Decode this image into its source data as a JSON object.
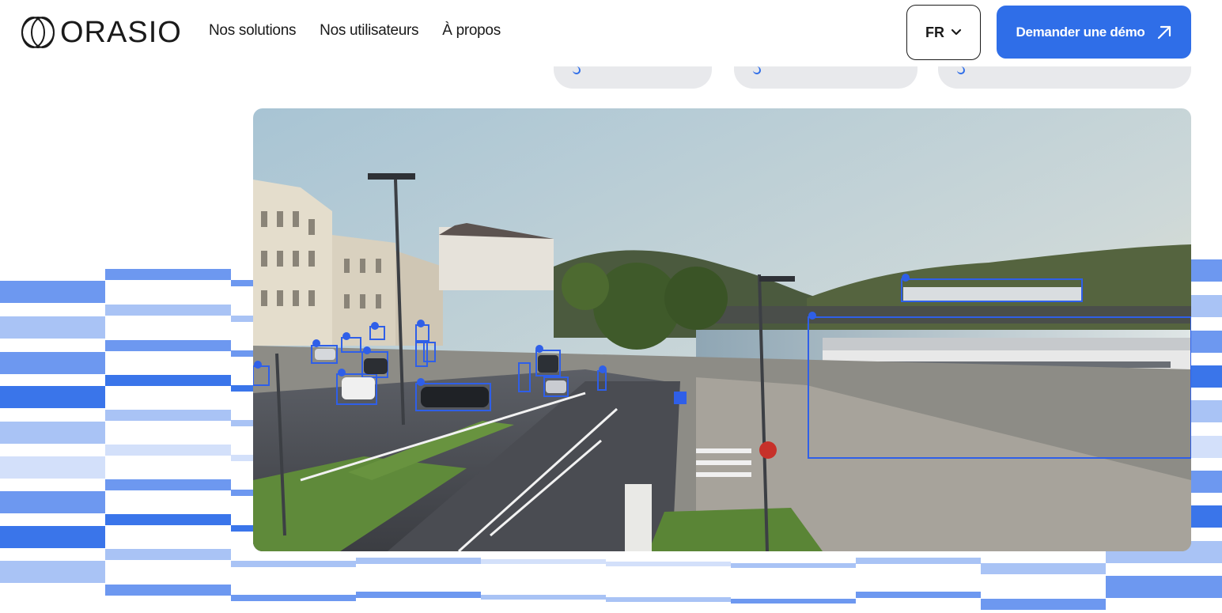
{
  "brand": {
    "name": "ORASIO",
    "logo_icon": "interlocking-rings-logo"
  },
  "nav": {
    "items": [
      {
        "label": "Nos solutions"
      },
      {
        "label": "Nos utilisateurs"
      },
      {
        "label": "À propos"
      }
    ]
  },
  "language": {
    "current": "FR",
    "icon": "chevron-down-icon"
  },
  "cta": {
    "label": "Demander une démo",
    "icon": "arrow-up-right-icon"
  },
  "colors": {
    "accent": "#2f6ee8",
    "stripe_dark": "#3a75ea",
    "stripe_mid": "#6d98f0",
    "stripe_light": "#a9c3f5",
    "stripe_pale": "#d3e0fa",
    "detection_box": "#2f5fe8"
  },
  "hero_media": {
    "type": "street-surveillance-video",
    "detections_overlay": true
  }
}
